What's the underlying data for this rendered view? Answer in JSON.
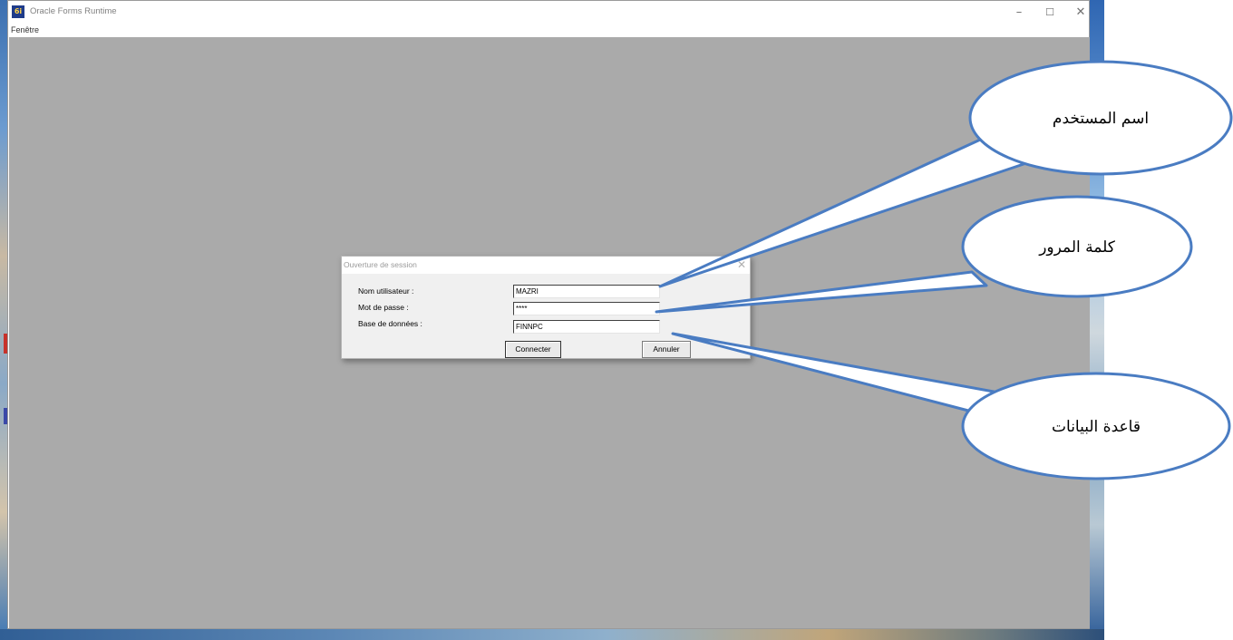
{
  "window": {
    "title": "Oracle Forms Runtime",
    "icon": "oracle-forms-app-icon",
    "controls": {
      "minimize": "–",
      "maximize": "☐",
      "close": "✕"
    }
  },
  "menu": {
    "items": [
      "Fenêtre"
    ]
  },
  "dialog": {
    "title": "Ouverture de session",
    "fields": {
      "user": {
        "label": "Nom utilisateur :",
        "value": "MAZRI"
      },
      "password": {
        "label": "Mot de passe :",
        "value": "****"
      },
      "database": {
        "label": "Base de données :",
        "value": "FINNPC"
      }
    },
    "buttons": {
      "connect": "Connecter",
      "cancel": "Annuler"
    }
  },
  "callouts": {
    "username": "اسم المستخدم",
    "password": "كلمة المرور",
    "database": "قاعدة البيانات",
    "fill_color": "#ffffff",
    "stroke_color": "#4a7cc2"
  },
  "colors": {
    "mdi_background": "#aaaaaa",
    "dialog_background": "#f0f0f0",
    "callout_border": "#4a7cc2"
  }
}
